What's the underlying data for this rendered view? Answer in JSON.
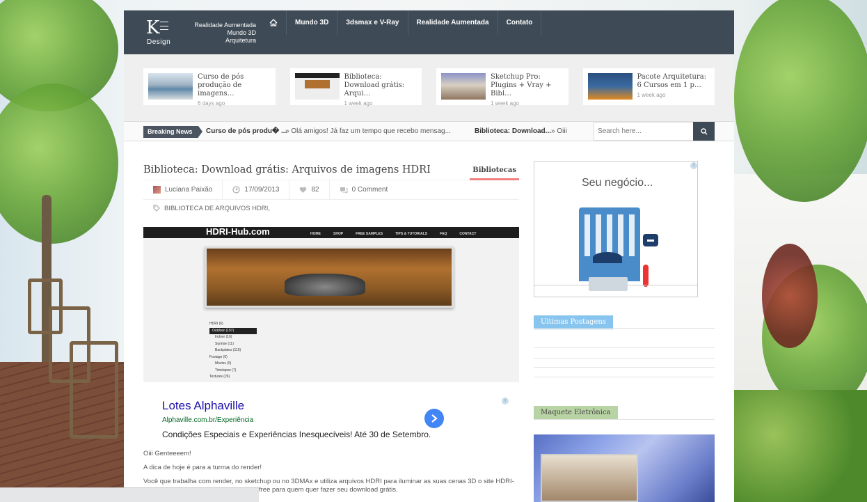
{
  "header": {
    "logo_letter": "K",
    "logo_subtitle": "Design",
    "tagline": [
      "Realidade Aumentada",
      "Mundo 3D",
      "Arquitetura"
    ],
    "nav": [
      {
        "label": "Mundo 3D"
      },
      {
        "label": "3dsmax e V-Ray"
      },
      {
        "label": "Realidade Aumentada"
      },
      {
        "label": "Contato"
      }
    ]
  },
  "featured": [
    {
      "title": "Curso de pós produção de imagens…",
      "date": "6 days ago"
    },
    {
      "title": "Biblioteca: Download grátis: Arqui…",
      "date": "1 week ago"
    },
    {
      "title": "Sketchup Pro: Plugins + Vray + Bibl…",
      "date": "1 week ago"
    },
    {
      "title": "Pacote Arquitetura: 6 Cursos em 1 p…",
      "date": "1 week ago"
    }
  ],
  "ticker": {
    "label": "Breaking News",
    "items": [
      {
        "title": "Curso de pós produ� ...",
        "excerpt": "Olá amigos! Já faz um tempo que recebo mensag..."
      },
      {
        "title": "Biblioteca: Download...",
        "excerpt": "Oiii"
      }
    ]
  },
  "search": {
    "placeholder": "Search here..."
  },
  "post": {
    "title": "Biblioteca: Download grátis: Arquivos de imagens HDRI",
    "category": "Bibliotecas",
    "author": "Luciana Paixão",
    "date": "17/09/2013",
    "likes": "82",
    "comments": "0 Comment",
    "tags": "BIBLIOTECA DE ARQUIVOS HDRI,",
    "image": {
      "site_name": "HDRI-Hub.com",
      "nav": [
        "HOME",
        "SHOP",
        "FREE SAMPLES",
        "TIPS & TUTORIALS",
        "FAQ",
        "CONTACT"
      ],
      "list": [
        "HDRI (6)",
        "Outdoor (197)",
        "Indoor (16)",
        "Sunrise (11)",
        "Backplates (115)",
        "Footage (0)",
        "Movies (0)",
        "Timelapse (7)",
        "Textures (26)"
      ]
    },
    "paragraphs": [
      "Oiii Genteeeem!",
      "A dica de hoje é para a turma do render!",
      "Você que trabalha com render, no sketchup ou no 3DMAx e utiliza arquivos HDRI para iluminar as suas cenas 3D o site HDRI-",
      "free para quem quer fazer seu download grátis."
    ]
  },
  "ad": {
    "title": "Lotes Alphaville",
    "url": "Alphaville.com.br/Experiência",
    "description": "Condições Especiais e Experiências Inesquecíveis! Até 30 de Setembro."
  },
  "sidebar": {
    "ad_text": "Seu negócio...",
    "widget1_title": "Ultimas Postagens",
    "widget2_title": "Maquete Eletrônica"
  }
}
